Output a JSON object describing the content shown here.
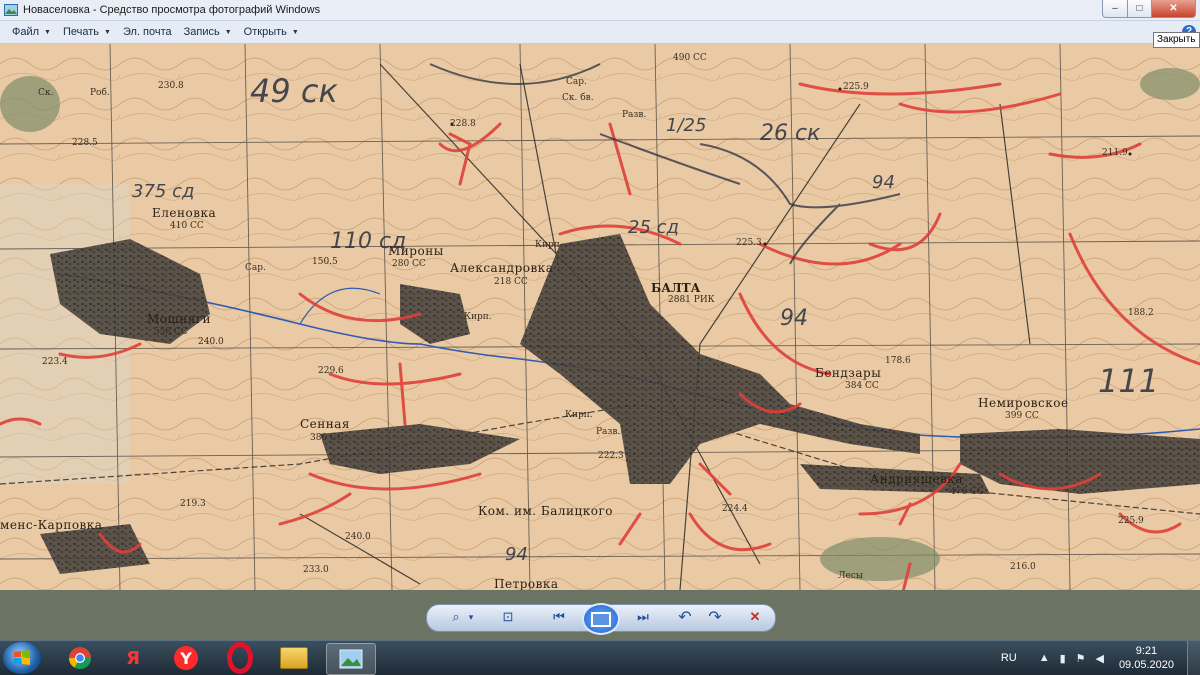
{
  "window": {
    "title": "Новаселовка - Средство просмотра фотографий Windows",
    "close_tooltip": "Закрыть",
    "min_symbol": "‒",
    "max_symbol": "□",
    "close_symbol": "✕"
  },
  "menu": {
    "items": [
      {
        "label": "Файл",
        "caret": "▼"
      },
      {
        "label": "Печать",
        "caret": "▼"
      },
      {
        "label": "Эл. почта",
        "caret": ""
      },
      {
        "label": "Запись",
        "caret": "▼"
      },
      {
        "label": "Открыть",
        "caret": "▼"
      }
    ],
    "help": "?"
  },
  "map": {
    "towns": {
      "balta": "БАЛТА",
      "balta_sub": "2881 РИК",
      "aleksandrovka": "Александровка",
      "aleksandrovka_sub": "218 СС",
      "elenovka": "Еленовка",
      "elenovka_sub": "410 СС",
      "mironi": "Мироны",
      "mironi_sub": "280 СС",
      "moshnyagi": "Мошняги",
      "moshnyagi_sub": "558 СС",
      "sennaya": "Сенная",
      "sennaya_sub": "380 СС",
      "bendzary": "Бендзары",
      "bendzary_sub": "384 СС",
      "nemirovskoe": "Немировское",
      "nemirovskoe_sub": "399 СС",
      "andriyashevka": "Андрияшевка",
      "andriyashevka_sub": "470 СС",
      "kom_balitskogo": "Ком. им. Балицкого",
      "petrovka": "Петровка",
      "karpovka": "менс-Карповка",
      "les": "Лесы"
    },
    "elevations": [
      "230.8",
      "228.8",
      "225.9",
      "211.9",
      "188.2",
      "178.6",
      "225.3",
      "229.6",
      "222.3",
      "224.4",
      "219.3",
      "240.0",
      "233.0",
      "216.0",
      "225.9",
      "228.5",
      "223.4",
      "150.5",
      "240.0",
      "490 СС"
    ],
    "small_labels": [
      "Сар.",
      "Ск. бв.",
      "Разв.",
      "Кирп.",
      "Кирп.",
      "Разв.",
      "Кирп.",
      "Сар.",
      "Ск.",
      "Роб."
    ],
    "unit_marks": {
      "ck49": "49 ск",
      "ck26": "26 ск",
      "cd375": "375 сд",
      "cd25": "25 сд",
      "cd110": "110 сд",
      "cd94a": "94",
      "cd94b": "94",
      "cd94c": "94",
      "cd111": "111",
      "frac": "1/25"
    }
  },
  "controls": {
    "zoom": "⌕",
    "fit": "⊡",
    "prev": "⏮",
    "next": "⏭",
    "rotate_ccw": "↶",
    "rotate_cw": "↷",
    "delete": "✕",
    "caret": "▾"
  },
  "taskbar": {
    "apps": [
      {
        "name": "chrome",
        "label": "●"
      },
      {
        "name": "yandex-browser",
        "label": "Я"
      },
      {
        "name": "yandex",
        "label": "Y"
      },
      {
        "name": "opera",
        "label": "O"
      },
      {
        "name": "explorer",
        "label": "▭"
      },
      {
        "name": "photo-viewer",
        "label": "▣"
      }
    ],
    "lang": "RU",
    "time": "9:21",
    "date": "09.05.2020"
  },
  "colors": {
    "map_paper": "#e8c9a3",
    "arrow_red": "#e0403a",
    "pencil": "#2a2f3f",
    "grid": "#3a3a3a"
  }
}
